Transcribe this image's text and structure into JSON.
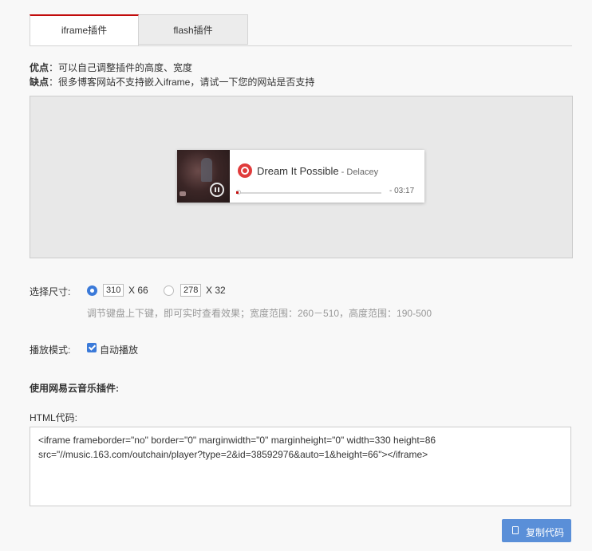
{
  "tabs": [
    {
      "label": "iframe插件",
      "active": true
    },
    {
      "label": "flash插件",
      "active": false
    }
  ],
  "description": {
    "pros_label": "优点",
    "pros_text": "：可以自己调整插件的高度、宽度",
    "cons_label": "缺点",
    "cons_text": "：很多博客网站不支持嵌入iframe，请试一下您的网站是否支持"
  },
  "player": {
    "song": "Dream It Possible",
    "artist": " - Delacey",
    "time": "- 03:17",
    "progress": 0.0
  },
  "size": {
    "label": "选择尺寸:",
    "options": [
      {
        "width": "310",
        "height": "X 66",
        "selected": true
      },
      {
        "width": "278",
        "height": "X 32",
        "selected": false
      }
    ],
    "hint": "调节键盘上下键，即可实时查看效果；宽度范围：260－510，高度范围：190-500"
  },
  "mode": {
    "label": "播放模式:",
    "autoplay_label": "自动播放",
    "autoplay": true
  },
  "plugin_heading": "使用网易云音乐插件:",
  "html_code": {
    "label": "HTML代码:",
    "value": "<iframe frameborder=\"no\" border=\"0\" marginwidth=\"0\" marginheight=\"0\" width=330 height=86 src=\"//music.163.com/outchain/player?type=2&id=38592976&auto=1&height=66\"></iframe>"
  },
  "copy_button": "复制代码",
  "colors": {
    "accent": "#c20c0c",
    "checkbox": "#3b7ad9",
    "button": "#5a8fd8"
  }
}
